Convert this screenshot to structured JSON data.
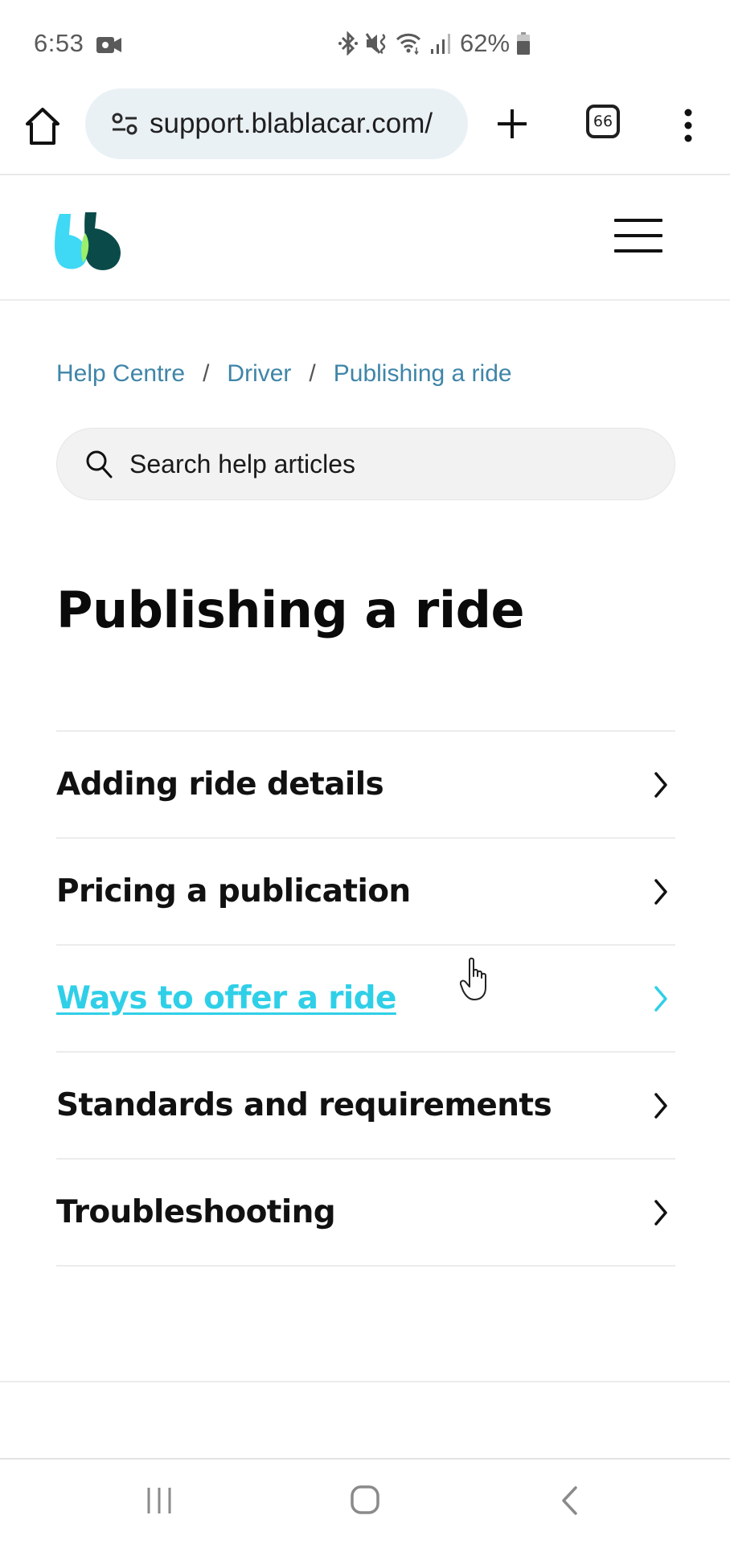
{
  "status_bar": {
    "time": "6:53",
    "battery_percent": "62%",
    "icons": [
      "screen-record-icon",
      "bluetooth-icon",
      "mute-vibrate-icon",
      "wifi-icon",
      "signal-icon",
      "battery-icon"
    ]
  },
  "browser": {
    "url": "support.blablacar.com/",
    "tab_count": "66",
    "icons": [
      "home-icon",
      "site-settings-icon",
      "new-tab-icon",
      "tabs-icon",
      "more-menu-icon"
    ]
  },
  "header": {
    "logo_alt": "BlaBlaCar",
    "logo_colors": [
      "#3fd8f5",
      "#9bef6a",
      "#0a4b4a"
    ],
    "menu_icon": "hamburger-icon"
  },
  "breadcrumb": {
    "items": [
      {
        "label": "Help Centre"
      },
      {
        "label": "Driver"
      },
      {
        "label": "Publishing a ride"
      }
    ],
    "separator": "/"
  },
  "search": {
    "placeholder": "Search help articles",
    "value": ""
  },
  "page": {
    "title": "Publishing a ride"
  },
  "topics": [
    {
      "label": "Adding ride details",
      "state": "default"
    },
    {
      "label": "Pricing a publication",
      "state": "default"
    },
    {
      "label": "Ways to offer a ride",
      "state": "hover"
    },
    {
      "label": "Standards and requirements",
      "state": "default"
    },
    {
      "label": "Troubleshooting",
      "state": "default"
    }
  ],
  "colors": {
    "link": "#3f85a8",
    "hover_accent": "#2fcfe8",
    "url_pill": "#eaf1f5",
    "search_bg": "#f2f2f2"
  },
  "nav_bar": {
    "buttons": [
      "recents",
      "home",
      "back"
    ]
  }
}
